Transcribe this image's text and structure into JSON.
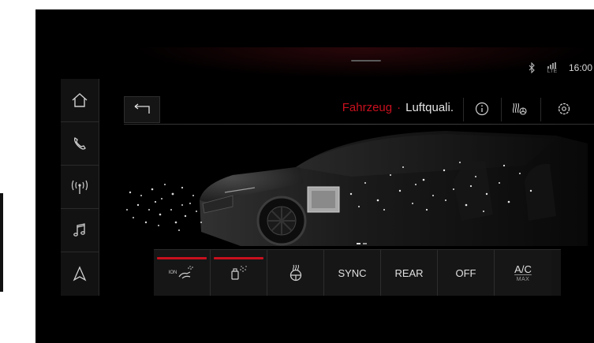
{
  "status": {
    "time": "16:00",
    "icons": [
      "bluetooth-icon",
      "lte-signal-icon"
    ],
    "lte_label": "LTE"
  },
  "sidebar": {
    "items": [
      {
        "name": "home",
        "icon": "home-icon"
      },
      {
        "name": "phone",
        "icon": "phone-icon"
      },
      {
        "name": "radio",
        "icon": "radio-antenna-icon"
      },
      {
        "name": "media",
        "icon": "music-note-icon"
      },
      {
        "name": "navigation",
        "icon": "navigation-arrow-icon"
      }
    ]
  },
  "header": {
    "back_icon": "back-arrow-icon",
    "breadcrumb_parent": "Fahrzeug",
    "breadcrumb_separator": "·",
    "breadcrumb_current": "Luftquali.",
    "actions": [
      {
        "name": "info",
        "icon": "info-icon"
      },
      {
        "name": "air-quality-settings",
        "icon": "fan-settings-icon"
      },
      {
        "name": "settings",
        "icon": "gear-icon"
      }
    ]
  },
  "pagination": {
    "count": 2,
    "active": 1
  },
  "climate_bar": {
    "ion_label": "ION",
    "buttons": [
      {
        "name": "ionizer",
        "icon": "ionizer-icon",
        "active": true
      },
      {
        "name": "fragrance",
        "icon": "fragrance-icon",
        "active": true
      },
      {
        "name": "steering-wheel-heat",
        "icon": "steering-wheel-heat-icon",
        "active": false
      },
      {
        "name": "sync",
        "label": "SYNC",
        "active": false
      },
      {
        "name": "rear",
        "label": "REAR",
        "active": false
      },
      {
        "name": "off",
        "label": "OFF",
        "active": false
      },
      {
        "name": "ac-max",
        "label": "A/C",
        "sublabel": "MAX",
        "active": false
      }
    ]
  },
  "colors": {
    "accent": "#c8101e",
    "background": "#000000",
    "text": "#e6e6e6",
    "panel": "#141414"
  }
}
